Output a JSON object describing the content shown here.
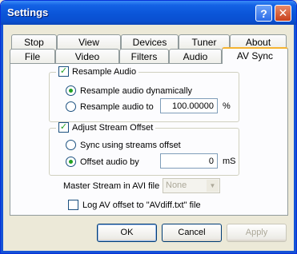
{
  "window": {
    "title": "Settings",
    "help_label": "?",
    "close_label": "✕"
  },
  "tabs_row1": [
    "Stop",
    "View",
    "Devices",
    "Tuner",
    "About"
  ],
  "tabs_row2": [
    "File",
    "Video",
    "Filters",
    "Audio",
    "AV Sync"
  ],
  "active_tab": "AV Sync",
  "resample_group": {
    "title": "Resample Audio",
    "checked": true,
    "option_dynamic": "Resample audio dynamically",
    "option_to": "Resample audio to",
    "selected": "dynamic",
    "rate_value": "100.00000",
    "rate_unit": "%"
  },
  "offset_group": {
    "title": "Adjust Stream Offset",
    "checked": true,
    "option_sync": "Sync using streams offset",
    "option_offset": "Offset audio by",
    "selected": "offset",
    "offset_value": "0",
    "offset_unit": "mS"
  },
  "master_stream": {
    "label": "Master Stream in AVI file",
    "value": "None"
  },
  "log_av": {
    "label": "Log AV offset to \"AVdiff.txt\" file",
    "checked": false
  },
  "buttons": {
    "ok": "OK",
    "cancel": "Cancel",
    "apply": "Apply"
  },
  "colors": {
    "accent": "#21a121",
    "titlebar": "#0a55d8",
    "active_tab_highlight": "#f5b331"
  }
}
